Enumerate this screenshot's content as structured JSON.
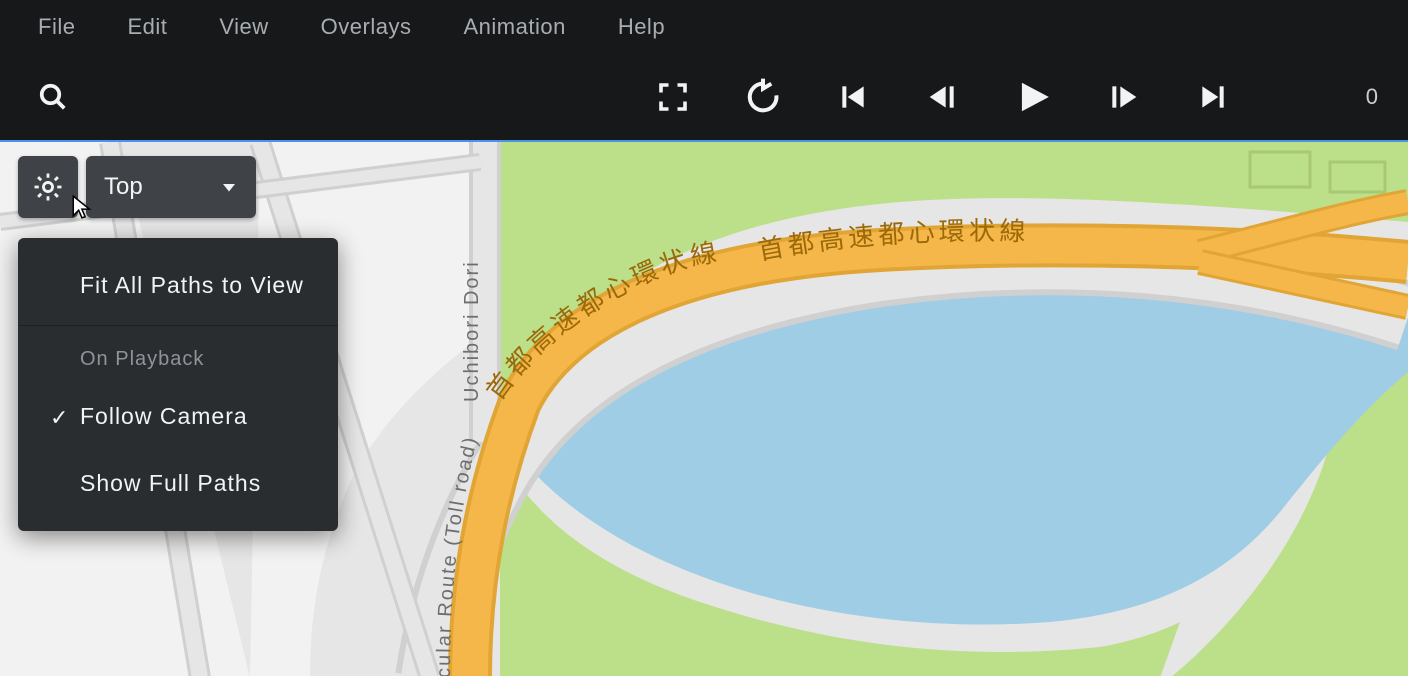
{
  "menubar": {
    "file": "File",
    "edit": "Edit",
    "view": "View",
    "overlays": "Overlays",
    "animation": "Animation",
    "help": "Help"
  },
  "toolbar": {
    "frame": "0"
  },
  "viewport": {
    "view_mode": "Top"
  },
  "gear_menu": {
    "fit_all": "Fit All Paths to View",
    "section": "On Playback",
    "follow_cam": "Follow Camera",
    "show_paths": "Show Full Paths",
    "follow_cam_checked": true
  },
  "map": {
    "road_vertical_en": "Uchibori Dori",
    "toll_label_en": "cular Route (Toll road)",
    "highway_jp_1": "首都高速都心環状線",
    "highway_jp_2": "首都高速都心環状線"
  }
}
